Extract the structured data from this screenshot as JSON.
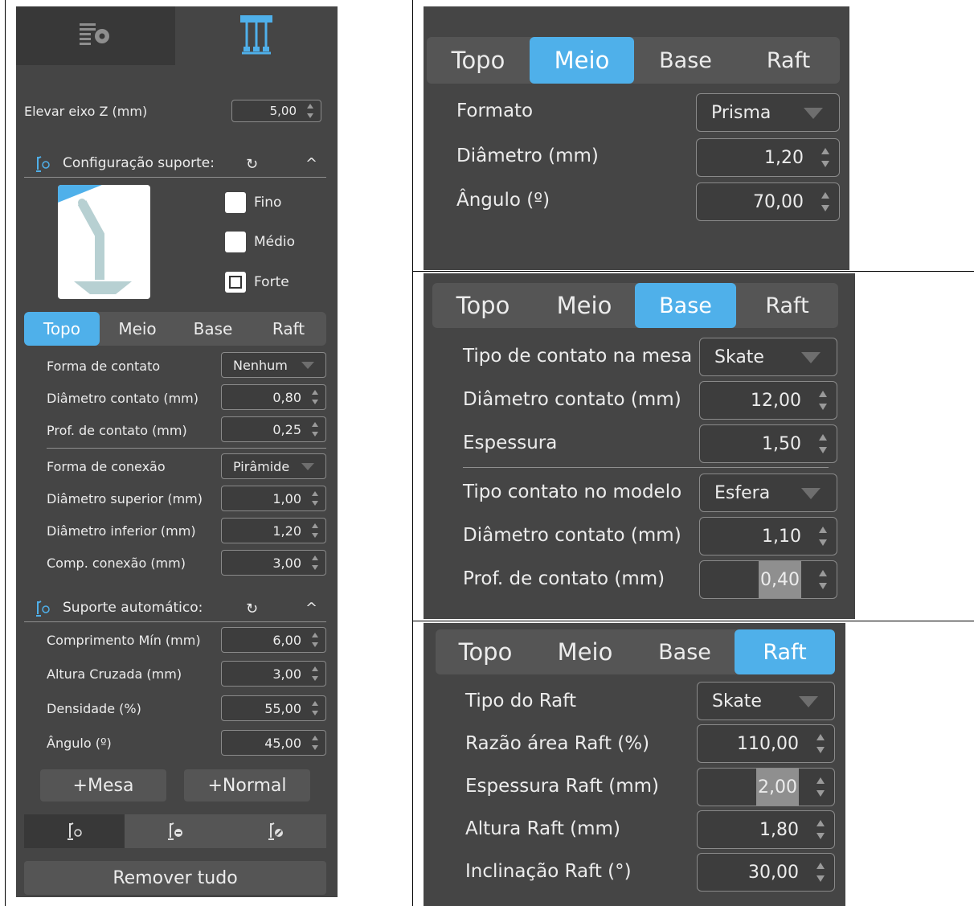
{
  "left": {
    "top_tabs": [
      {
        "icon": "settings-icon"
      },
      {
        "icon": "support-structure-icon"
      }
    ],
    "elevar": {
      "label": "Elevar eixo Z (mm)",
      "value": "5,00"
    },
    "config_section": {
      "title": "Configuração suporte:",
      "icon": "support-icon"
    },
    "checkboxes": [
      {
        "label": "Fino",
        "state": "unchecked"
      },
      {
        "label": "Médio",
        "state": "unchecked"
      },
      {
        "label": "Forte",
        "state": "partial"
      }
    ],
    "tabs": [
      "Topo",
      "Meio",
      "Base",
      "Raft"
    ],
    "active_tab": "Topo",
    "topo_fields": [
      {
        "label": "Forma de contato",
        "type": "combo",
        "value": "Nenhum"
      },
      {
        "label": "Diâmetro contato (mm)",
        "type": "spin",
        "value": "0,80"
      },
      {
        "label": "Prof. de contato (mm)",
        "type": "spin",
        "value": "0,25"
      },
      {
        "label": "Forma de conexão",
        "type": "combo",
        "value": "Pirâmide"
      },
      {
        "label": "Diâmetro superior (mm)",
        "type": "spin",
        "value": "1,00"
      },
      {
        "label": "Diâmetro inferior (mm)",
        "type": "spin",
        "value": "1,20"
      },
      {
        "label": "Comp. conexão (mm)",
        "type": "spin",
        "value": "3,00"
      }
    ],
    "auto_section": {
      "title": "Suporte automático:",
      "icon": "support-icon"
    },
    "auto_fields": [
      {
        "label": "Comprimento Mín (mm)",
        "value": "6,00"
      },
      {
        "label": "Altura Cruzada (mm)",
        "value": "3,00"
      },
      {
        "label": "Densidade (%)",
        "value": "55,00"
      },
      {
        "label": "Ângulo (º)",
        "value": "45,00"
      }
    ],
    "buttons": {
      "mesa": "+Mesa",
      "normal": "+Normal",
      "remove_all": "Remover tudo"
    },
    "icon_strip": [
      "support-add-icon",
      "support-remove-icon",
      "support-edit-icon"
    ]
  },
  "meio_panel": {
    "tabs": [
      "Topo",
      "Meio",
      "Base",
      "Raft"
    ],
    "active_tab": "Meio",
    "fields": [
      {
        "label": "Formato",
        "type": "combo",
        "value": "Prisma"
      },
      {
        "label": "Diâmetro (mm)",
        "type": "spin",
        "value": "1,20"
      },
      {
        "label": "Ângulo (º)",
        "type": "spin",
        "value": "70,00"
      }
    ]
  },
  "base_panel": {
    "tabs": [
      "Topo",
      "Meio",
      "Base",
      "Raft"
    ],
    "active_tab": "Base",
    "fields": [
      {
        "label": "Tipo de contato na mesa",
        "type": "combo",
        "value": "Skate"
      },
      {
        "label": "Diâmetro contato (mm)",
        "type": "spin",
        "value": "12,00"
      },
      {
        "label": "Espessura",
        "type": "spin",
        "value": "1,50"
      },
      {
        "label": "Tipo contato no modelo",
        "type": "combo",
        "value": "Esfera"
      },
      {
        "label": "Diâmetro contato (mm)",
        "type": "spin",
        "value": "1,10"
      },
      {
        "label": "Prof. de contato (mm)",
        "type": "spin",
        "value": "0,40"
      }
    ]
  },
  "raft_panel": {
    "tabs": [
      "Topo",
      "Meio",
      "Base",
      "Raft"
    ],
    "active_tab": "Raft",
    "fields": [
      {
        "label": "Tipo do Raft",
        "type": "combo",
        "value": "Skate"
      },
      {
        "label": "Razão área Raft (%)",
        "type": "spin",
        "value": "110,00"
      },
      {
        "label": "Espessura Raft (mm)",
        "type": "spin",
        "value": "2,00"
      },
      {
        "label": "Altura Raft (mm)",
        "type": "spin",
        "value": "1,80"
      },
      {
        "label": "Inclinação Raft (°)",
        "type": "spin",
        "value": "30,00"
      }
    ]
  },
  "colors": {
    "panel_bg": "#454545",
    "accent": "#4fb0ea",
    "tab_bg": "#555555",
    "text": "#ececec"
  }
}
